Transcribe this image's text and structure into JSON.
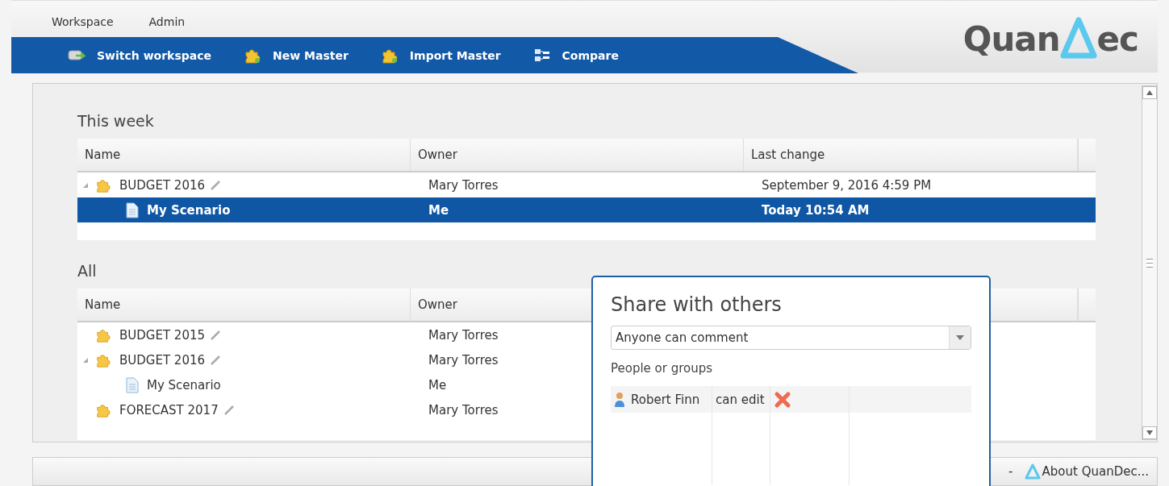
{
  "menu": [
    "Workspace",
    "Admin"
  ],
  "toolbar": [
    {
      "label": "Switch workspace",
      "kind": "switch"
    },
    {
      "label": "New Master",
      "kind": "puzzle"
    },
    {
      "label": "Import Master",
      "kind": "puzzle"
    },
    {
      "label": "Compare",
      "kind": "compare"
    }
  ],
  "logo": {
    "text_before": "Quan",
    "text_after": "ec"
  },
  "sections": [
    {
      "title": "This week",
      "columns": [
        "Name",
        "Owner",
        "Last change"
      ],
      "rows": [
        {
          "name": "BUDGET 2016",
          "kind": "master",
          "expanded": true,
          "owner": "Mary Torres",
          "last_change": "September 9, 2016 4:59 PM",
          "selected": false,
          "children": [
            {
              "name": "My Scenario",
              "kind": "scenario",
              "owner": "Me",
              "last_change": "Today 10:54 AM",
              "selected": true
            }
          ]
        }
      ]
    },
    {
      "title": "All",
      "columns": [
        "Name",
        "Owner"
      ],
      "rows": [
        {
          "name": "BUDGET 2015",
          "kind": "master",
          "owner": "Mary Torres",
          "selected": false
        },
        {
          "name": "BUDGET 2016",
          "kind": "master",
          "expanded": true,
          "owner": "Mary Torres",
          "selected": false,
          "children": [
            {
              "name": "My Scenario",
              "kind": "scenario",
              "owner": "Me",
              "selected": false
            }
          ]
        },
        {
          "name": "FORECAST 2017",
          "kind": "master",
          "owner": "Mary Torres",
          "selected": false
        }
      ]
    }
  ],
  "footer": {
    "separator": "-",
    "about": "About QuanDec..."
  },
  "dialog": {
    "title": "Share with others",
    "access": "Anyone can comment",
    "people_label": "People or groups",
    "people": [
      {
        "name": "Robert Finn",
        "permission": "can edit"
      }
    ]
  }
}
